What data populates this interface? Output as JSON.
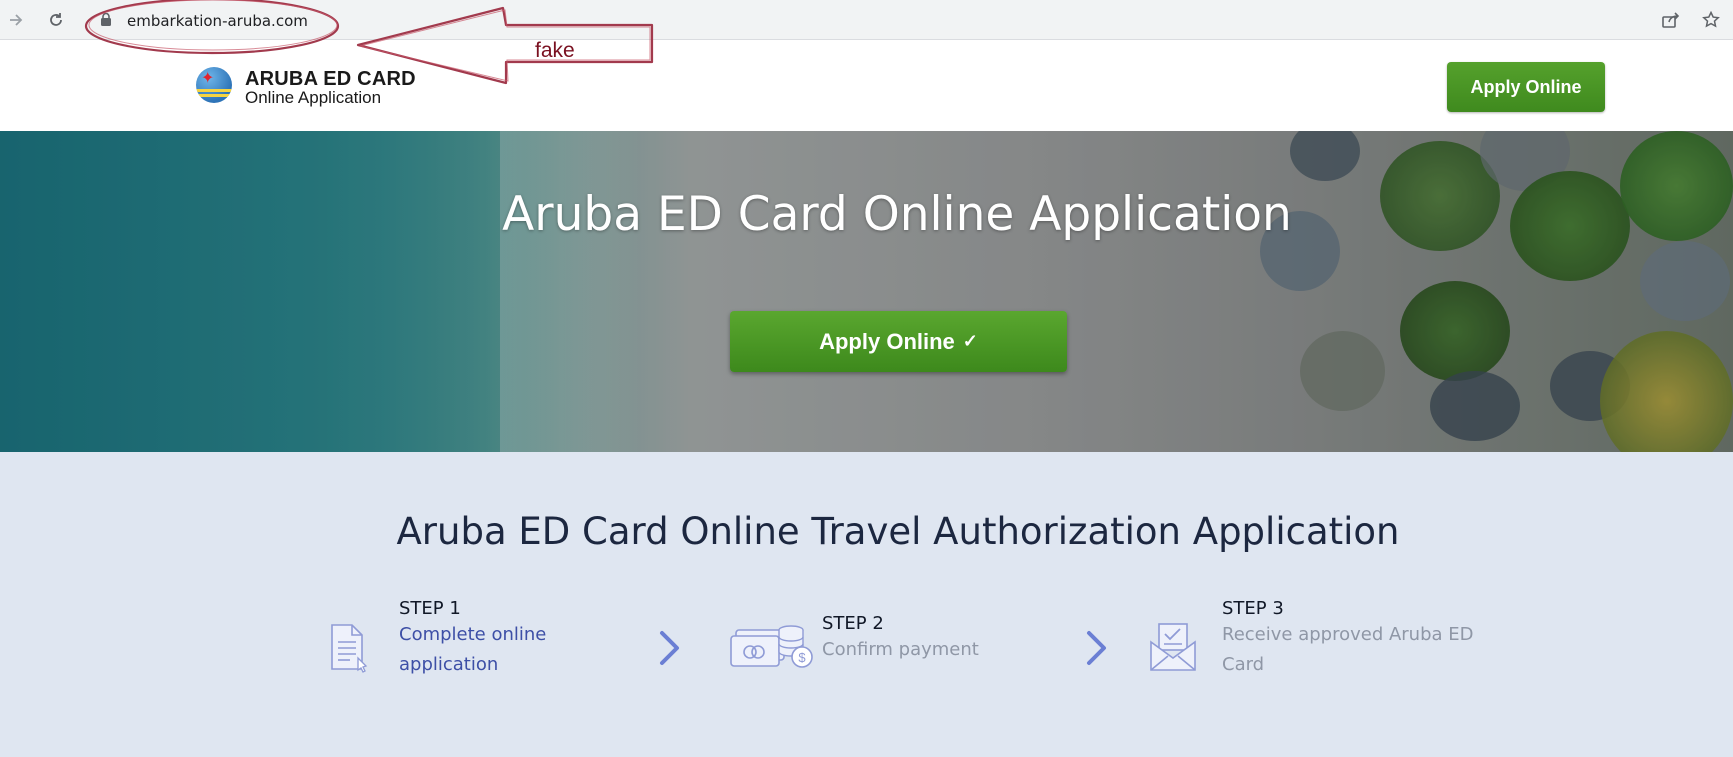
{
  "browser": {
    "url": "embarkation-aruba.com"
  },
  "annotation": {
    "label": "fake",
    "color": "#7a1020"
  },
  "header": {
    "logo_title": "ARUBA ED CARD",
    "logo_subtitle": "Online Application",
    "apply_label": "Apply Online"
  },
  "hero": {
    "title": "Aruba ED Card Online Application",
    "apply_label": "Apply Online",
    "apply_icon": "check-icon"
  },
  "steps_section": {
    "title": "Aruba ED Card Online Travel Authorization Application",
    "steps": [
      {
        "label": "STEP 1",
        "desc_line1": "Complete online",
        "desc_line2": "application",
        "icon": "document-icon"
      },
      {
        "label": "STEP 2",
        "desc_line1": "Confirm payment",
        "desc_line2": "",
        "icon": "payment-icon"
      },
      {
        "label": "STEP 3",
        "desc_line1": "Receive approved Aruba ED",
        "desc_line2": "Card",
        "icon": "envelope-icon"
      }
    ]
  },
  "colors": {
    "accent_green": "#4a9625",
    "steps_background": "#dfe6f1",
    "active_step_text": "#3d4fa6",
    "chevron": "#6b7fd4"
  }
}
